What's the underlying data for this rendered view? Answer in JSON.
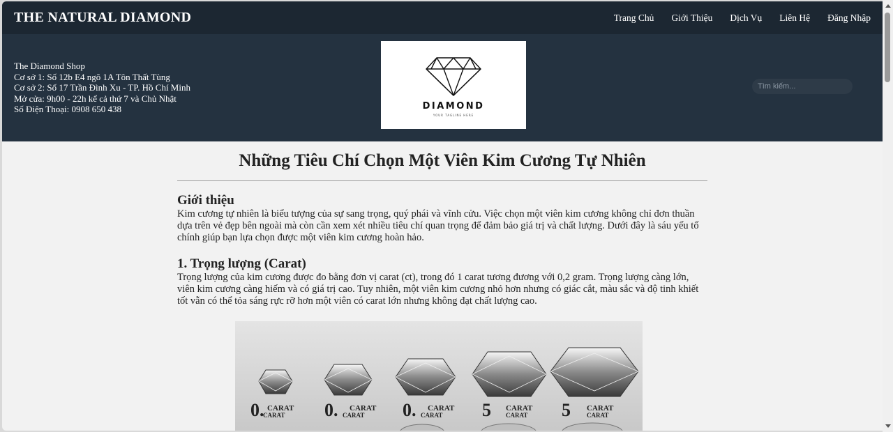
{
  "brand": "THE NATURAL DIAMOND",
  "nav": [
    {
      "label": "Trang Chủ"
    },
    {
      "label": "Giới Thiệu"
    },
    {
      "label": "Dịch Vụ"
    },
    {
      "label": "Liên Hệ"
    },
    {
      "label": "Đăng Nhập"
    }
  ],
  "shop": {
    "name": "The Diamond Shop",
    "branch1": "Cơ sở 1: Số 12b E4 ngõ 1A Tôn Thất Tùng",
    "branch2": "Cơ sở 2: Số 17 Trần Đình Xu - TP. Hồ Chí Minh",
    "hours": "Mở cửa: 9h00 - 22h kể cả thứ 7 và Chủ Nhật",
    "phone": "Số Điện Thoại: 0908 650 438"
  },
  "logo": {
    "text": "DIAMOND",
    "tagline": "YOUR TAGLINE HERE"
  },
  "search": {
    "placeholder": "Tìm kiếm..."
  },
  "article": {
    "title": "Những Tiêu Chí Chọn Một Viên Kim Cương Tự Nhiên",
    "intro_heading": "Giới thiệu",
    "intro_text": "Kim cương tự nhiên là biểu tượng của sự sang trọng, quý phái và vĩnh cửu. Việc chọn một viên kim cương không chỉ đơn thuần dựa trên vẻ đẹp bên ngoài mà còn cần xem xét nhiều tiêu chí quan trọng để đảm bảo giá trị và chất lượng. Dưới đây là sáu yếu tố chính giúp bạn lựa chọn được một viên kim cương hoàn hảo.",
    "section1_heading": "1. Trọng lượng (Carat)",
    "section1_text": "Trọng lượng của kim cương được đo bằng đơn vị carat (ct), trong đó 1 carat tương đương với 0,2 gram. Trọng lượng càng lớn, viên kim cương càng hiếm và có giá trị cao. Tuy nhiên, một viên kim cương nhỏ hơn nhưng có giác cắt, màu sắc và độ tinh khiết tốt vẫn có thể tỏa sáng rực rỡ hơn một viên có carat lớn nhưng không đạt chất lượng cao."
  },
  "photo": {
    "labels": [
      {
        "num": "0.",
        "top": "CARAT",
        "bottom": "CARAT"
      },
      {
        "num": "0.",
        "top": "CARAT",
        "bottom": "CARAT"
      },
      {
        "num": "0.",
        "top": "CARAT",
        "bottom": "CARAT"
      },
      {
        "num": "5",
        "top": "CARAT",
        "bottom": "CARAT"
      },
      {
        "num": "5",
        "top": "CARAT",
        "bottom": "CARAT"
      }
    ]
  }
}
